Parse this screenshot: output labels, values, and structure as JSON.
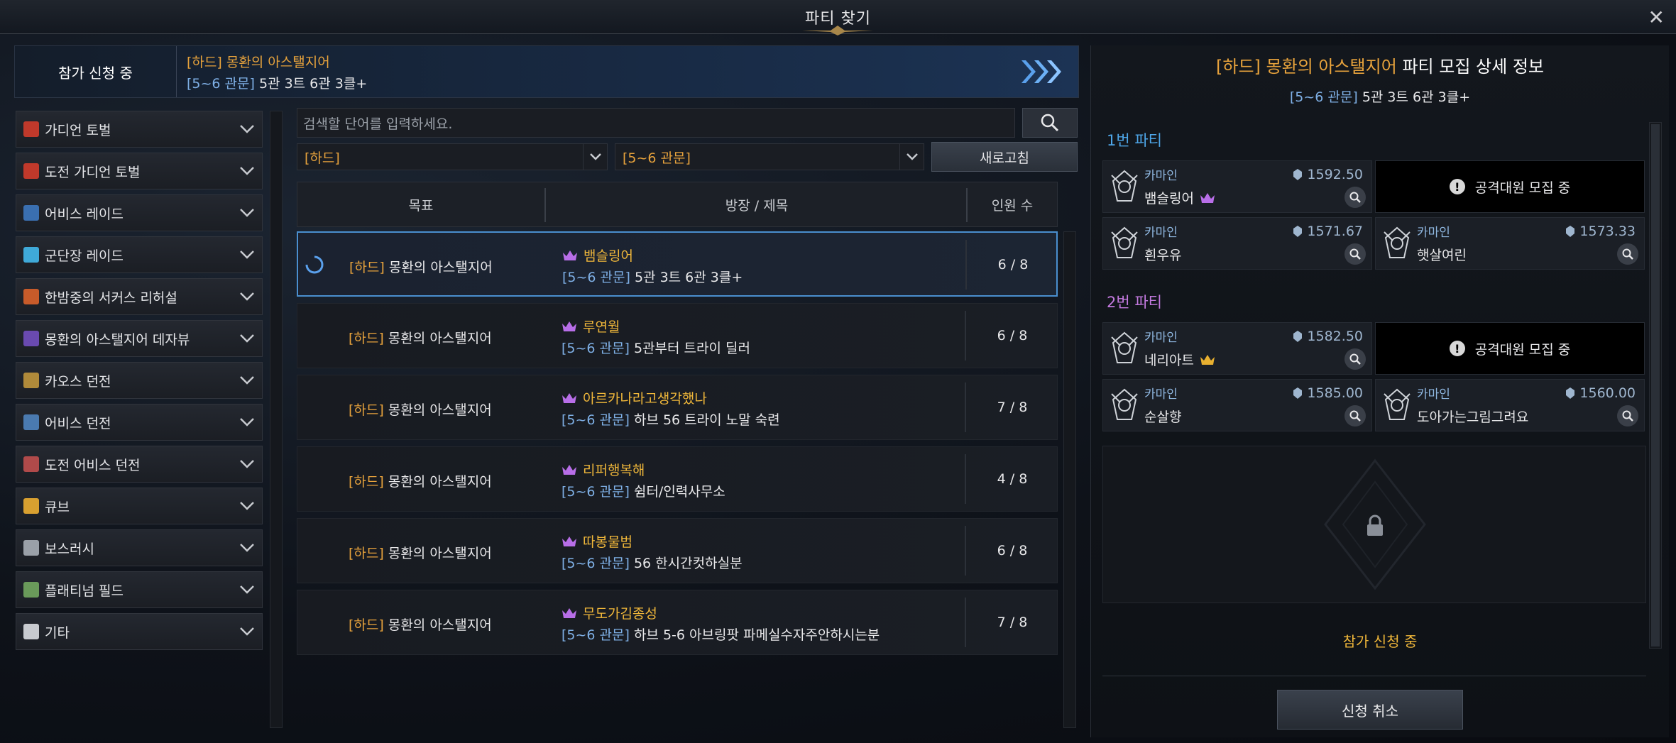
{
  "window": {
    "title": "파티 찾기"
  },
  "applying": {
    "state": "참가 신청 중",
    "line1": "[하드] 몽환의 아스탤지어",
    "line2_tag": "[5~6 관문]",
    "line2_text": "5관 3트 6관 3클+"
  },
  "categories": [
    {
      "label": "가디언 토벌",
      "icon": "guardian-icon",
      "color": "#c0392b"
    },
    {
      "label": "도전 가디언 토벌",
      "icon": "challenge-guardian-icon",
      "color": "#c0392b"
    },
    {
      "label": "어비스 레이드",
      "icon": "abyss-raid-icon",
      "color": "#3a6fb0"
    },
    {
      "label": "군단장 레이드",
      "icon": "legion-raid-icon",
      "color": "#3fa9d8"
    },
    {
      "label": "한밤중의 서커스 리허설",
      "icon": "circus-icon",
      "color": "#c75b2a"
    },
    {
      "label": "몽환의 아스탤지어 데자뷰",
      "icon": "dejavu-icon",
      "color": "#6a4ab0"
    },
    {
      "label": "카오스 던전",
      "icon": "chaos-dungeon-icon",
      "color": "#b08a3a"
    },
    {
      "label": "어비스 던전",
      "icon": "abyss-dungeon-icon",
      "color": "#4a7ab0"
    },
    {
      "label": "도전 어비스 던전",
      "icon": "challenge-abyss-icon",
      "color": "#b04a4a"
    },
    {
      "label": "큐브",
      "icon": "cube-icon",
      "color": "#d8a030"
    },
    {
      "label": "보스러시",
      "icon": "boss-rush-icon",
      "color": "#9aa0a8"
    },
    {
      "label": "플래티넘 필드",
      "icon": "platinum-field-icon",
      "color": "#6a9a5a"
    },
    {
      "label": "기타",
      "icon": "more-icon",
      "color": "#c8cbd0"
    }
  ],
  "search": {
    "placeholder": "검색할 단어를 입력하세요."
  },
  "filters": {
    "difficulty": "[하드]",
    "gate": "[5~6 관문]",
    "refresh_label": "새로고침"
  },
  "table": {
    "headers": {
      "goal": "목표",
      "title": "방장 / 제목",
      "count": "인원 수"
    },
    "rows": [
      {
        "goal_tag": "[하드]",
        "goal": "몽환의 아스탤지어",
        "leader": "뱀슬링어",
        "desc_tag": "[5~6 관문]",
        "desc": "5관 3트 6관 3클+",
        "count": "6 / 8",
        "selected": true
      },
      {
        "goal_tag": "[하드]",
        "goal": "몽환의 아스탤지어",
        "leader": "루연월",
        "desc_tag": "[5~6 관문]",
        "desc": "5관부터 트라이 딜러",
        "count": "6 / 8",
        "selected": false
      },
      {
        "goal_tag": "[하드]",
        "goal": "몽환의 아스탤지어",
        "leader": "아르카나라고생각했나",
        "desc_tag": "[5~6 관문]",
        "desc": "하브 56 트라이 노말 숙련",
        "count": "7 / 8",
        "selected": false
      },
      {
        "goal_tag": "[하드]",
        "goal": "몽환의 아스탤지어",
        "leader": "리퍼행복해",
        "desc_tag": "[5~6 관문]",
        "desc": "쉼터/인력사무소",
        "count": "4 / 8",
        "selected": false
      },
      {
        "goal_tag": "[하드]",
        "goal": "몽환의 아스탤지어",
        "leader": "따봉물범",
        "desc_tag": "[5~6 관문]",
        "desc": "56 한시간컷하실분",
        "count": "6 / 8",
        "selected": false
      },
      {
        "goal_tag": "[하드]",
        "goal": "몽환의 아스탤지어",
        "leader": "무도가김종성",
        "desc_tag": "[5~6 관문]",
        "desc": "하브 5-6 아브링팟 파메실수자주안하시는분",
        "count": "7 / 8",
        "selected": false
      }
    ]
  },
  "detail": {
    "title_orange": "[하드] 몽환의 아스탤지어",
    "title_rest": "파티 모집 상세 정보",
    "sub_tag": "[5~6 관문]",
    "sub_text": "5관 3트 6관 3클+",
    "party1_label": "1번 파티",
    "party2_label": "2번 파티",
    "party1": [
      {
        "class": "카마인",
        "name": "뱀슬링어",
        "ilvl": "1592.50",
        "crown": "purple"
      },
      {
        "recruit": "공격대원 모집 중"
      },
      {
        "class": "카마인",
        "name": "흰우유",
        "ilvl": "1571.67"
      },
      {
        "class": "카마인",
        "name": "햇살여린",
        "ilvl": "1573.33"
      }
    ],
    "party2": [
      {
        "class": "카마인",
        "name": "네리아트",
        "ilvl": "1582.50",
        "crown": "gold"
      },
      {
        "recruit": "공격대원 모집 중"
      },
      {
        "class": "카마인",
        "name": "순살향",
        "ilvl": "1585.00"
      },
      {
        "class": "카마인",
        "name": "도아가는그림그려요",
        "ilvl": "1560.00"
      }
    ],
    "status": "참가 신청 중",
    "cancel_label": "신청 취소"
  },
  "colors": {
    "accent_orange": "#e8a33c",
    "tag_blue": "#7fb0e6",
    "party1": "#4ea6e8",
    "party2": "#c47ae0",
    "leader_gold": "#f0b73a"
  }
}
